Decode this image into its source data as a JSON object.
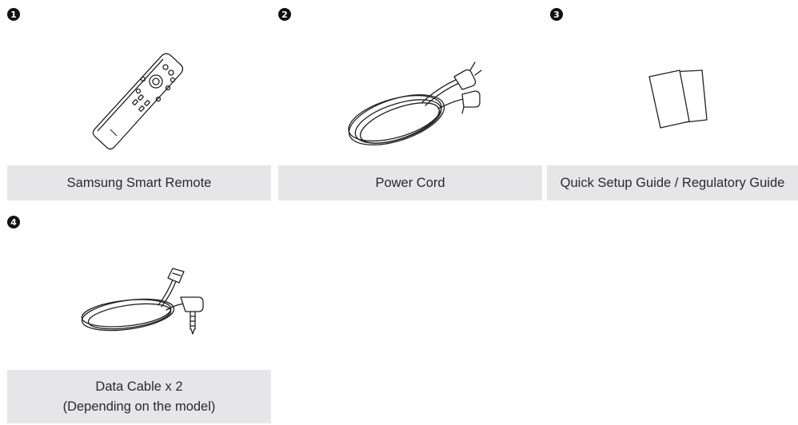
{
  "components": [
    {
      "number": "1",
      "label": "Samsung Smart Remote",
      "icon": "remote-control-icon"
    },
    {
      "number": "2",
      "label": "Power Cord",
      "icon": "power-cord-icon"
    },
    {
      "number": "3",
      "label": "Quick Setup Guide / Regulatory Guide",
      "icon": "manuals-icon"
    },
    {
      "number": "4",
      "label_lines": [
        "Data Cable x 2",
        "(Depending on the model)"
      ],
      "icon": "data-cable-icon"
    }
  ],
  "colors": {
    "caption_bg": "#e6e6e8",
    "badge_bg": "#111111",
    "line": "#222222"
  }
}
